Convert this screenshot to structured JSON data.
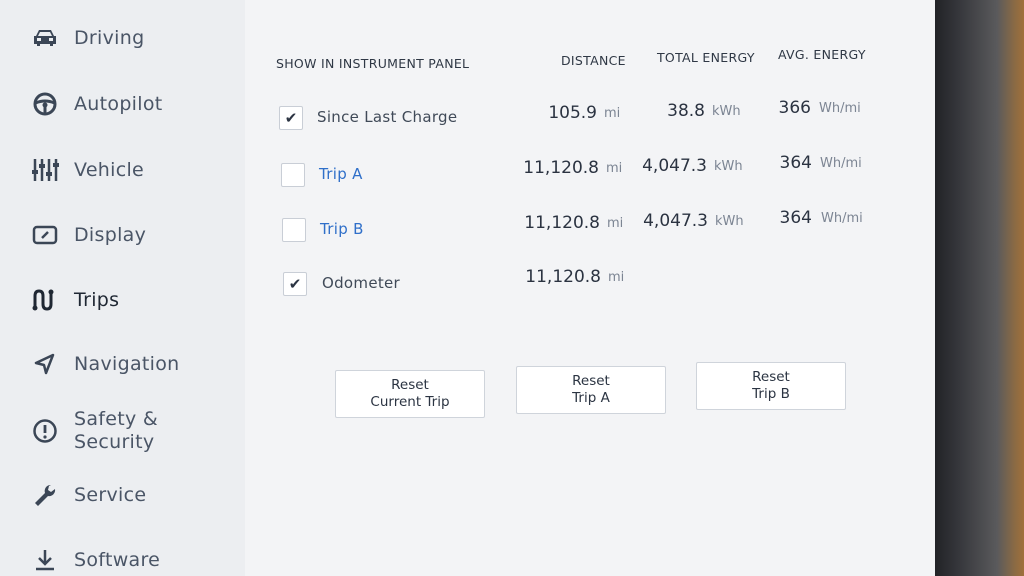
{
  "sidebar": {
    "items": [
      {
        "label": "Driving",
        "icon": "car-icon"
      },
      {
        "label": "Autopilot",
        "icon": "steering-wheel-icon"
      },
      {
        "label": "Vehicle",
        "icon": "sliders-icon"
      },
      {
        "label": "Display",
        "icon": "display-icon"
      },
      {
        "label": "Trips",
        "icon": "trip-route-icon"
      },
      {
        "label": "Navigation",
        "icon": "navigation-arrow-icon"
      },
      {
        "label": "Safety &",
        "label2": "Security",
        "icon": "alert-circle-icon"
      },
      {
        "label": "Service",
        "icon": "wrench-icon"
      },
      {
        "label": "Software",
        "icon": "download-icon"
      }
    ],
    "active": "Trips"
  },
  "trips": {
    "headers": {
      "show": "SHOW IN INSTRUMENT PANEL",
      "distance": "DISTANCE",
      "total_energy": "TOTAL ENERGY",
      "avg_energy": "AVG. ENERGY"
    },
    "rows": [
      {
        "label": "Since Last Charge",
        "checked": true,
        "check_glyph": "✔",
        "distance": "105.9",
        "distance_unit": "mi",
        "energy": "38.8",
        "energy_unit": "kWh",
        "avg": "366",
        "avg_unit": "Wh/mi"
      },
      {
        "label": "Trip A",
        "checked": false,
        "check_glyph": "",
        "distance": "11,120.8",
        "distance_unit": "mi",
        "energy": "4,047.3",
        "energy_unit": "kWh",
        "avg": "364",
        "avg_unit": "Wh/mi"
      },
      {
        "label": "Trip B",
        "checked": false,
        "check_glyph": "",
        "distance": "11,120.8",
        "distance_unit": "mi",
        "energy": "4,047.3",
        "energy_unit": "kWh",
        "avg": "364",
        "avg_unit": "Wh/mi"
      },
      {
        "label": "Odometer",
        "checked": true,
        "check_glyph": "✔",
        "distance": "11,120.8",
        "distance_unit": "mi"
      }
    ],
    "buttons": [
      {
        "line1": "Reset",
        "line2": "Current Trip"
      },
      {
        "line1": "Reset",
        "line2": "Trip A"
      },
      {
        "line1": "Reset",
        "line2": "Trip B"
      }
    ]
  }
}
